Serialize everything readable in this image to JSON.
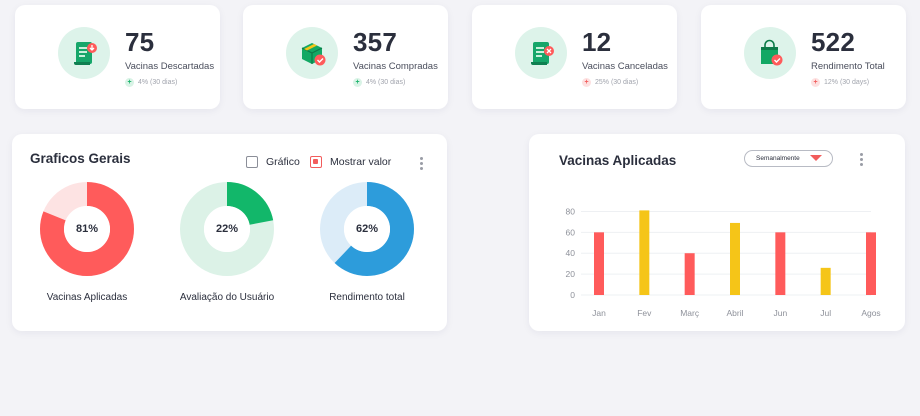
{
  "stats": [
    {
      "value": "75",
      "label": "Vacinas Descartadas",
      "trend": "4% (30 dias)",
      "direction": "up",
      "icon": "document-download-icon"
    },
    {
      "value": "357",
      "label": "Vacinas Compradas",
      "trend": "4% (30 dias)",
      "direction": "up",
      "icon": "box-check-icon"
    },
    {
      "value": "12",
      "label": "Vacinas Canceladas",
      "trend": "25% (30 dias)",
      "direction": "down",
      "icon": "document-cancel-icon"
    },
    {
      "value": "522",
      "label": "Rendimento Total",
      "trend": "12% (30 days)",
      "direction": "down",
      "icon": "shopping-bag-check-icon"
    }
  ],
  "graficos": {
    "title": "Graficos Gerais",
    "option_grafico": "Gráfico",
    "option_mostrar": "Mostrar valor",
    "donuts": [
      {
        "label": "Vacinas Aplicadas",
        "percent": 81,
        "percent_text": "81%",
        "color": "#ff5b5b",
        "track": "#fde3e3"
      },
      {
        "label": "Avaliação do Usuário",
        "percent": 22,
        "percent_text": "22%",
        "color": "#12b76a",
        "track": "#dcf2e7"
      },
      {
        "label": "Rendimento total",
        "percent": 62,
        "percent_text": "62%",
        "color": "#2d9cdb",
        "track": "#dcecf8"
      }
    ]
  },
  "aplicadas": {
    "title": "Vacinas Aplicadas",
    "period": "Semanalmente",
    "chart_data": {
      "type": "bar",
      "categories": [
        "Jan",
        "Fev",
        "Març",
        "Abril",
        "Jun",
        "Jul",
        "Agos"
      ],
      "values": [
        60,
        81,
        40,
        69,
        60,
        26,
        60
      ],
      "colors": [
        "#ff5b5b",
        "#f5c518",
        "#ff5b5b",
        "#f5c518",
        "#ff5b5b",
        "#f5c518",
        "#ff5b5b"
      ],
      "yticks": [
        0,
        20,
        40,
        60,
        80
      ],
      "ylim": [
        0,
        90
      ],
      "grid": true
    }
  }
}
